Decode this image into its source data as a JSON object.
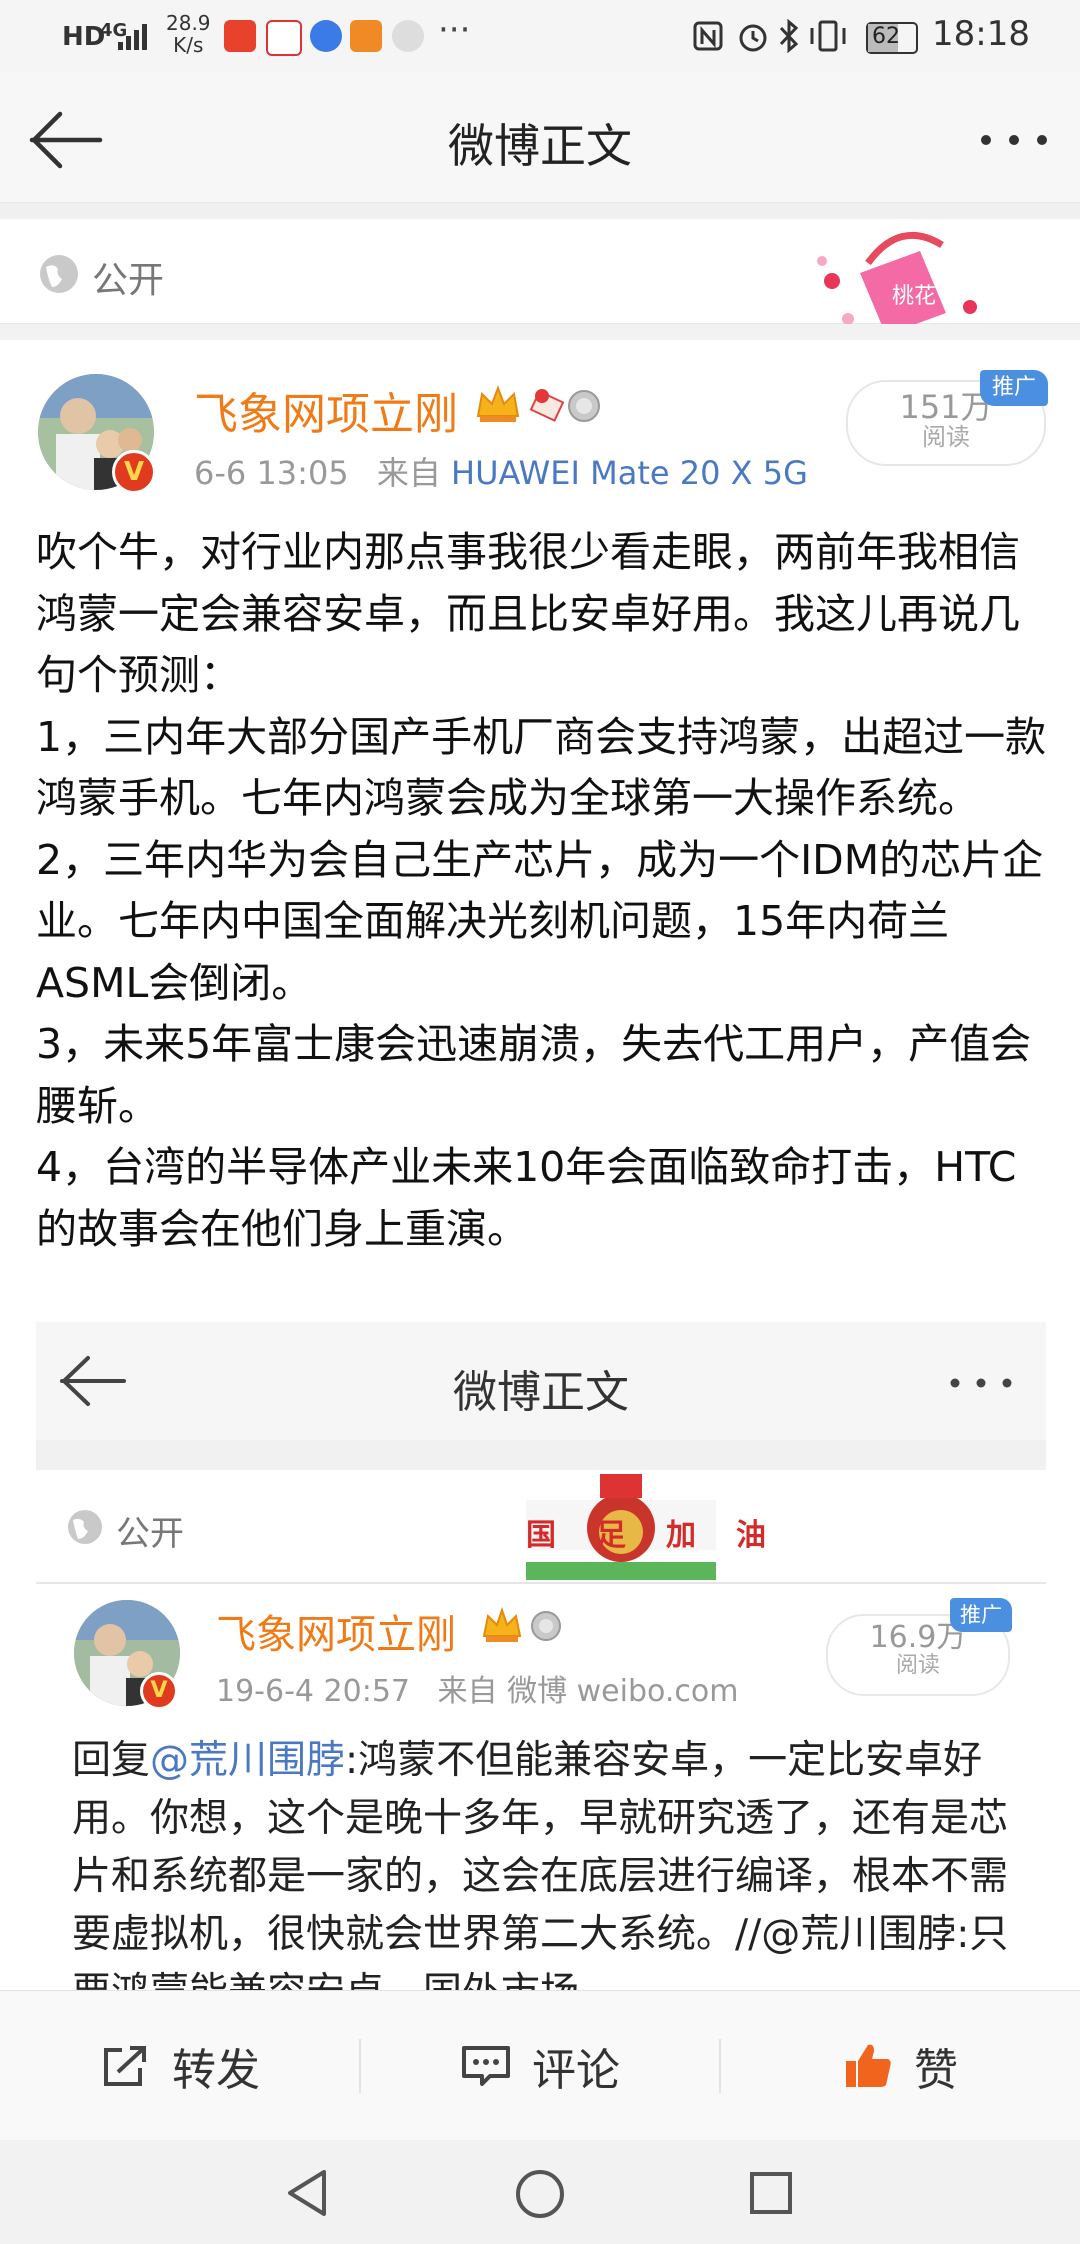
{
  "status_bar": {
    "network": "HD",
    "signal": "4G",
    "speed_value": "28.9",
    "speed_unit": "K/s",
    "battery": "62",
    "time": "18:18"
  },
  "header": {
    "title": "微博正文",
    "back_icon": "arrow-left-icon",
    "more_icon": "more-dots-icon"
  },
  "visibility": {
    "label": "公开",
    "icon": "globe-icon"
  },
  "post": {
    "username": "飞象网项立刚",
    "timestamp": "6-6 13:05",
    "source_prefix": "来自",
    "source": "HUAWEI Mate 20 X 5G",
    "read_count": "151万",
    "read_label": "阅读",
    "promo_badge": "推广",
    "paragraphs": [
      "吹个牛，对行业内那点事我很少看走眼，两前年我相信鸿蒙一定会兼容安卓，而且比安卓好用。我这儿再说几句个预测：",
      "1，三内年大部分国产手机厂商会支持鸿蒙，出超过一款鸿蒙手机。七年内鸿蒙会成为全球第一大操作系统。",
      "2，三年内华为会自己生产芯片，成为一个IDM的芯片企业。七年内中国全面解决光刻机问题，15年内荷兰ASML会倒闭。",
      "3，未来5年富士康会迅速崩溃，失去代工用户，产值会腰斩。",
      "4，台湾的半导体产业未来10年会面临致命打击，HTC的故事会在他们身上重演。"
    ]
  },
  "embedded": {
    "title": "微博正文",
    "visibility_label": "公开",
    "banner_text": "国足加油",
    "username": "飞象网项立刚",
    "timestamp": "19-6-4 20:57",
    "source_prefix": "来自",
    "source": "微博 weibo.com",
    "read_count": "16.9万",
    "read_label": "阅读",
    "promo_badge": "推广",
    "reply_prefix": "回复",
    "mention": "@荒川围脖",
    "body_1": ":鸿蒙不但能兼容安卓，一定比安卓好用。你想，这个是晚十多年，早就研究透了，还有是芯片和系统都是一家的，这会在底层进行编译，根本不需要虚拟机，很快就会世界第二大系",
    "body_2": "统。//@荒川围脖:只要鸿蒙能兼容安卓，国外市场"
  },
  "actions": {
    "repost": "转发",
    "comment": "评论",
    "like": "赞"
  },
  "colors": {
    "username": "#f07b16",
    "link": "#4a78c2",
    "badge": "#4b8fe0",
    "like": "#f0641e"
  }
}
